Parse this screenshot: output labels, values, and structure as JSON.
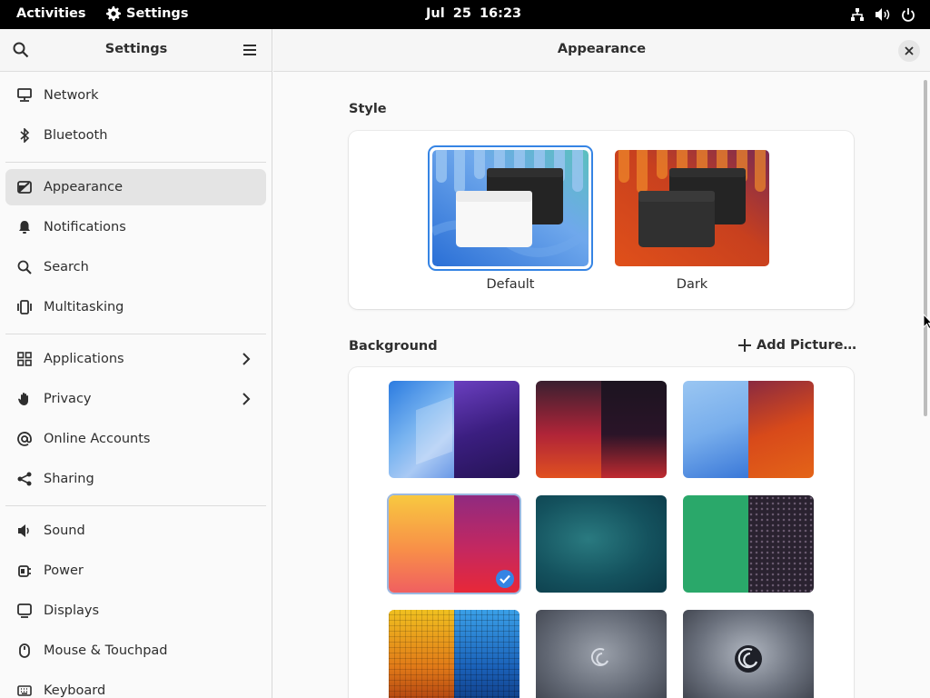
{
  "topbar": {
    "activities": "Activities",
    "app_name": "Settings",
    "clock": "Jul 25 16:23"
  },
  "sidebar": {
    "title": "Settings",
    "items": [
      {
        "label": "Network",
        "icon": "network-icon"
      },
      {
        "label": "Bluetooth",
        "icon": "bluetooth-icon"
      },
      {
        "label": "Appearance",
        "icon": "appearance-icon",
        "active": true
      },
      {
        "label": "Notifications",
        "icon": "bell-icon"
      },
      {
        "label": "Search",
        "icon": "search-icon"
      },
      {
        "label": "Multitasking",
        "icon": "multitasking-icon"
      },
      {
        "label": "Applications",
        "icon": "applications-icon",
        "has_submenu": true
      },
      {
        "label": "Privacy",
        "icon": "hand-icon",
        "has_submenu": true
      },
      {
        "label": "Online Accounts",
        "icon": "at-icon"
      },
      {
        "label": "Sharing",
        "icon": "share-icon"
      },
      {
        "label": "Sound",
        "icon": "speaker-icon"
      },
      {
        "label": "Power",
        "icon": "power-plug-icon"
      },
      {
        "label": "Displays",
        "icon": "display-icon"
      },
      {
        "label": "Mouse & Touchpad",
        "icon": "mouse-icon"
      },
      {
        "label": "Keyboard",
        "icon": "keyboard-icon"
      }
    ]
  },
  "main": {
    "title": "Appearance",
    "style": {
      "label": "Style",
      "options": [
        {
          "label": "Default",
          "selected": true
        },
        {
          "label": "Dark",
          "selected": false
        }
      ]
    },
    "background": {
      "label": "Background",
      "add_picture": "Add Picture…",
      "selected_index": 3
    }
  },
  "colors": {
    "accent": "#3584e4",
    "topbar": "#000000",
    "sidebar_active": "#e4e4e4"
  }
}
